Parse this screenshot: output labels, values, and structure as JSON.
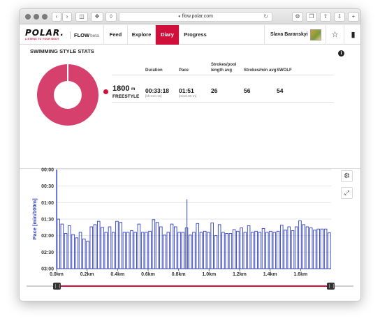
{
  "browser": {
    "url": "flow.polar.com"
  },
  "nav": {
    "logo": "POLAR.",
    "tagline": "LISTENS TO YOUR BODY",
    "flow_logo": "FLOW",
    "flow_sub": "beta",
    "items": [
      {
        "label": "Feed"
      },
      {
        "label": "Explore"
      },
      {
        "label": "Diary",
        "active": true
      },
      {
        "label": "Progress"
      }
    ],
    "user_name": "Slava Baranskyi"
  },
  "stats": {
    "title": "SWIMMING STYLE STATS",
    "headers": {
      "duration": "Duration",
      "pace": "Pace",
      "strokes_pool": "Strokes/pool",
      "length_avg": "length avg",
      "strokes_min": "Strokes/min avg",
      "swolf": "SWOLF"
    },
    "row": {
      "distance": "1800",
      "distance_unit": "m",
      "style": "FREESTYLE",
      "duration": "00:33:18",
      "duration_unit": "[hh:mm:ss]",
      "pace": "01:51",
      "pace_unit": "[min/100 m]",
      "strokes_pool": "26",
      "strokes_min": "56",
      "swolf": "54"
    },
    "color": "#d6406c"
  },
  "chart_data": {
    "type": "bar",
    "ylabel": "Pace [min/100m]",
    "y_ticks": [
      "00:00",
      "00:30",
      "01:00",
      "01:30",
      "02:00",
      "02:30",
      "03:00"
    ],
    "x_ticks": [
      "0.0km",
      "0.2km",
      "0.4km",
      "0.6km",
      "0.8km",
      "1.0km",
      "1.2km",
      "1.4km",
      "1.6km"
    ],
    "xlim_km": [
      0,
      1.8
    ],
    "ylim_sec": [
      0,
      180
    ],
    "series_color": "#2f3fc0",
    "pace_seconds": [
      90,
      99,
      116,
      102,
      118,
      124,
      114,
      126,
      130,
      104,
      100,
      94,
      105,
      114,
      104,
      114,
      94,
      96,
      114,
      114,
      111,
      114,
      99,
      114,
      114,
      112,
      91,
      96,
      104,
      119,
      114,
      99,
      104,
      114,
      114,
      106,
      119,
      114,
      98,
      114,
      112,
      114,
      97,
      120,
      100,
      114,
      116,
      116,
      109,
      112,
      106,
      114,
      102,
      114,
      112,
      114,
      107,
      114,
      112,
      114,
      112,
      101,
      110,
      104,
      111,
      104,
      93,
      100,
      104,
      106,
      110,
      108,
      108,
      108,
      115
    ]
  },
  "controls": {
    "gear_icon": "gear-icon",
    "expand_icon": "expand-icon"
  }
}
